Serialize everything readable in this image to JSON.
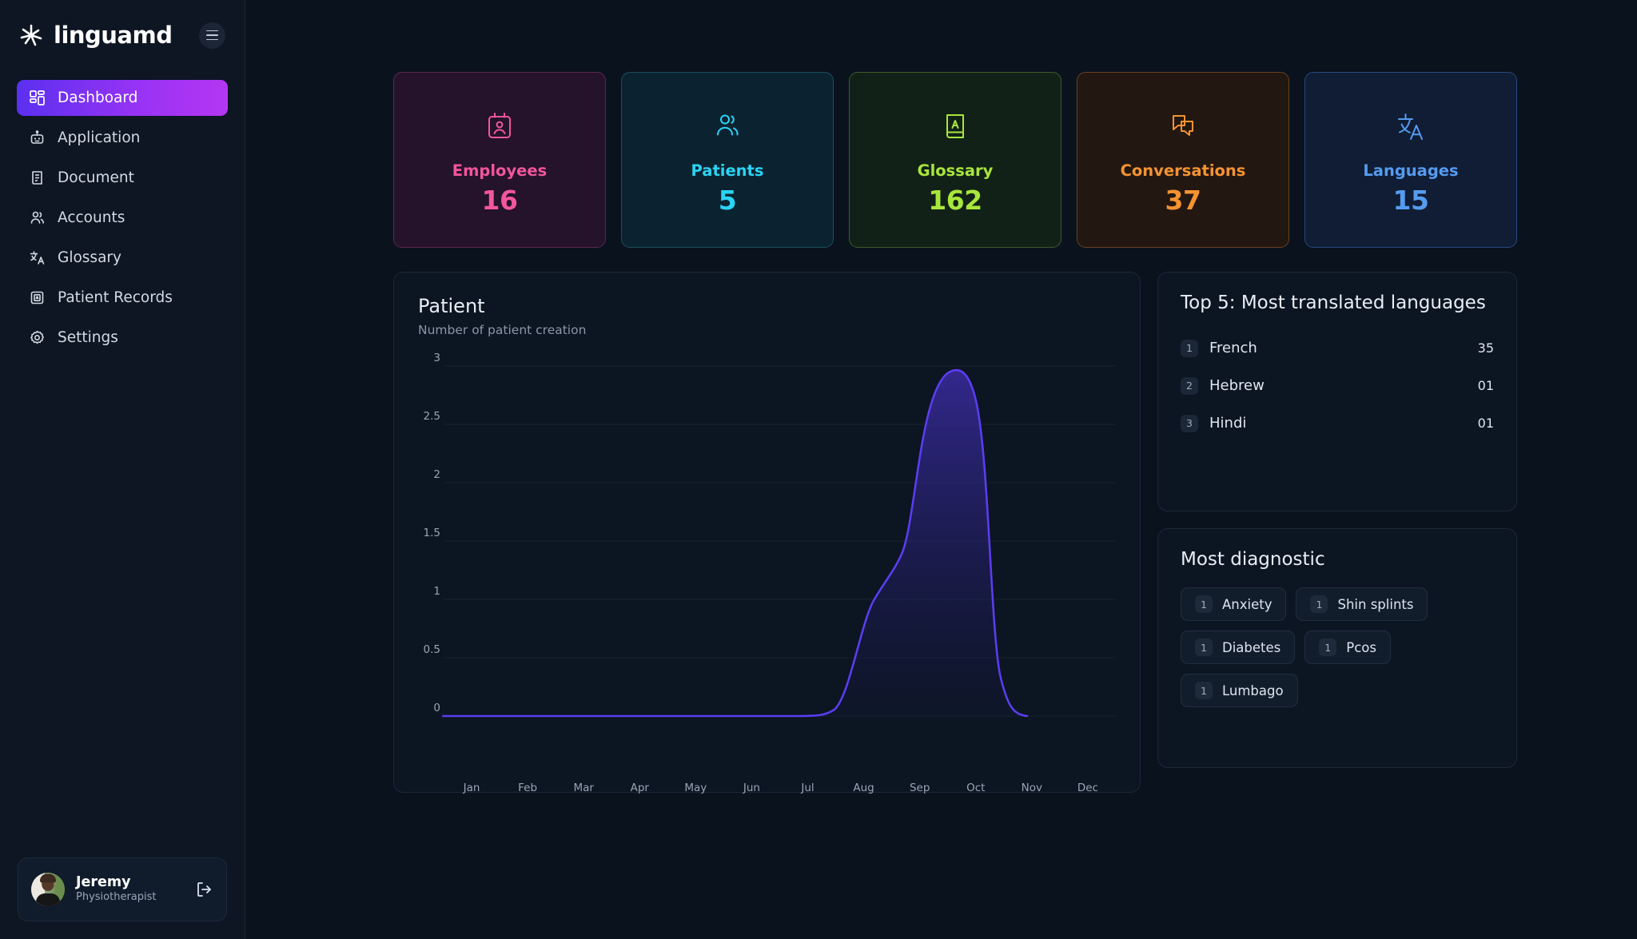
{
  "brand": {
    "name": "linguamd",
    "logo_icon": "linguamd-star-icon",
    "menu_icon": "hamburger-icon"
  },
  "sidebar": {
    "items": [
      {
        "label": "Dashboard",
        "icon": "grid-dashboard-icon",
        "active": true
      },
      {
        "label": "Application",
        "icon": "robot-icon",
        "active": false
      },
      {
        "label": "Document",
        "icon": "scroll-document-icon",
        "active": false
      },
      {
        "label": "Accounts",
        "icon": "users-icon",
        "active": false
      },
      {
        "label": "Glossary",
        "icon": "translate-icon",
        "active": false
      },
      {
        "label": "Patient Records",
        "icon": "id-card-icon",
        "active": false
      },
      {
        "label": "Settings",
        "icon": "gear-icon",
        "active": false
      }
    ],
    "user": {
      "name": "Jeremy",
      "role": "Physiotherapist",
      "logout_icon": "logout-icon",
      "avatar": "user-avatar"
    }
  },
  "stats": [
    {
      "label": "Employees",
      "value": "16",
      "icon": "employee-badge-icon",
      "color": "#f2569c",
      "bg": "#24132a",
      "border": "#5c2a49"
    },
    {
      "label": "Patients",
      "value": "5",
      "icon": "patients-icon",
      "color": "#2ad4f5",
      "bg": "#0b2331",
      "border": "#1d4d5e"
    },
    {
      "label": "Glossary",
      "value": "162",
      "icon": "glossary-book-icon",
      "color": "#a8e63c",
      "bg": "#122118",
      "border": "#3d5a2b"
    },
    {
      "label": "Conversations",
      "value": "37",
      "icon": "chat-bubbles-icon",
      "color": "#f59331",
      "bg": "#231711",
      "border": "#6a4123"
    },
    {
      "label": "Languages",
      "value": "15",
      "icon": "translate-icon",
      "color": "#559bf0",
      "bg": "#101d35",
      "border": "#2a4a80"
    }
  ],
  "chart_panel": {
    "title": "Patient",
    "subtitle": "Number of patient creation"
  },
  "chart_data": {
    "type": "area",
    "title": "Patient",
    "subtitle": "Number of patient creation",
    "xlabel": "",
    "ylabel": "",
    "categories": [
      "Jan",
      "Feb",
      "Mar",
      "Apr",
      "May",
      "Jun",
      "Jul",
      "Aug",
      "Sep",
      "Oct",
      "Nov",
      "Dec"
    ],
    "values": [
      0,
      0,
      0,
      0,
      0,
      0,
      0,
      0,
      0,
      2,
      2.9,
      0
    ],
    "ylim": [
      0,
      3
    ],
    "yticks": [
      "0",
      "0.5",
      "1",
      "1.5",
      "2",
      "2.5",
      "3"
    ],
    "ytick_values": [
      0,
      0.5,
      1,
      1.5,
      2,
      2.5,
      3
    ],
    "grid": true,
    "legend": "none",
    "line_color": "#5b3df0",
    "fill_color": "#3a2a9e"
  },
  "languages_panel": {
    "title": "Top 5: Most translated languages",
    "rows": [
      {
        "rank": "1",
        "name": "French",
        "count": "35"
      },
      {
        "rank": "2",
        "name": "Hebrew",
        "count": "01"
      },
      {
        "rank": "3",
        "name": "Hindi",
        "count": "01"
      }
    ]
  },
  "diagnostic_panel": {
    "title": "Most diagnostic",
    "chips": [
      {
        "count": "1",
        "label": "Anxiety"
      },
      {
        "count": "1",
        "label": "Shin splints"
      },
      {
        "count": "1",
        "label": "Diabetes"
      },
      {
        "count": "1",
        "label": "Pcos"
      },
      {
        "count": "1",
        "label": "Lumbago"
      }
    ]
  }
}
